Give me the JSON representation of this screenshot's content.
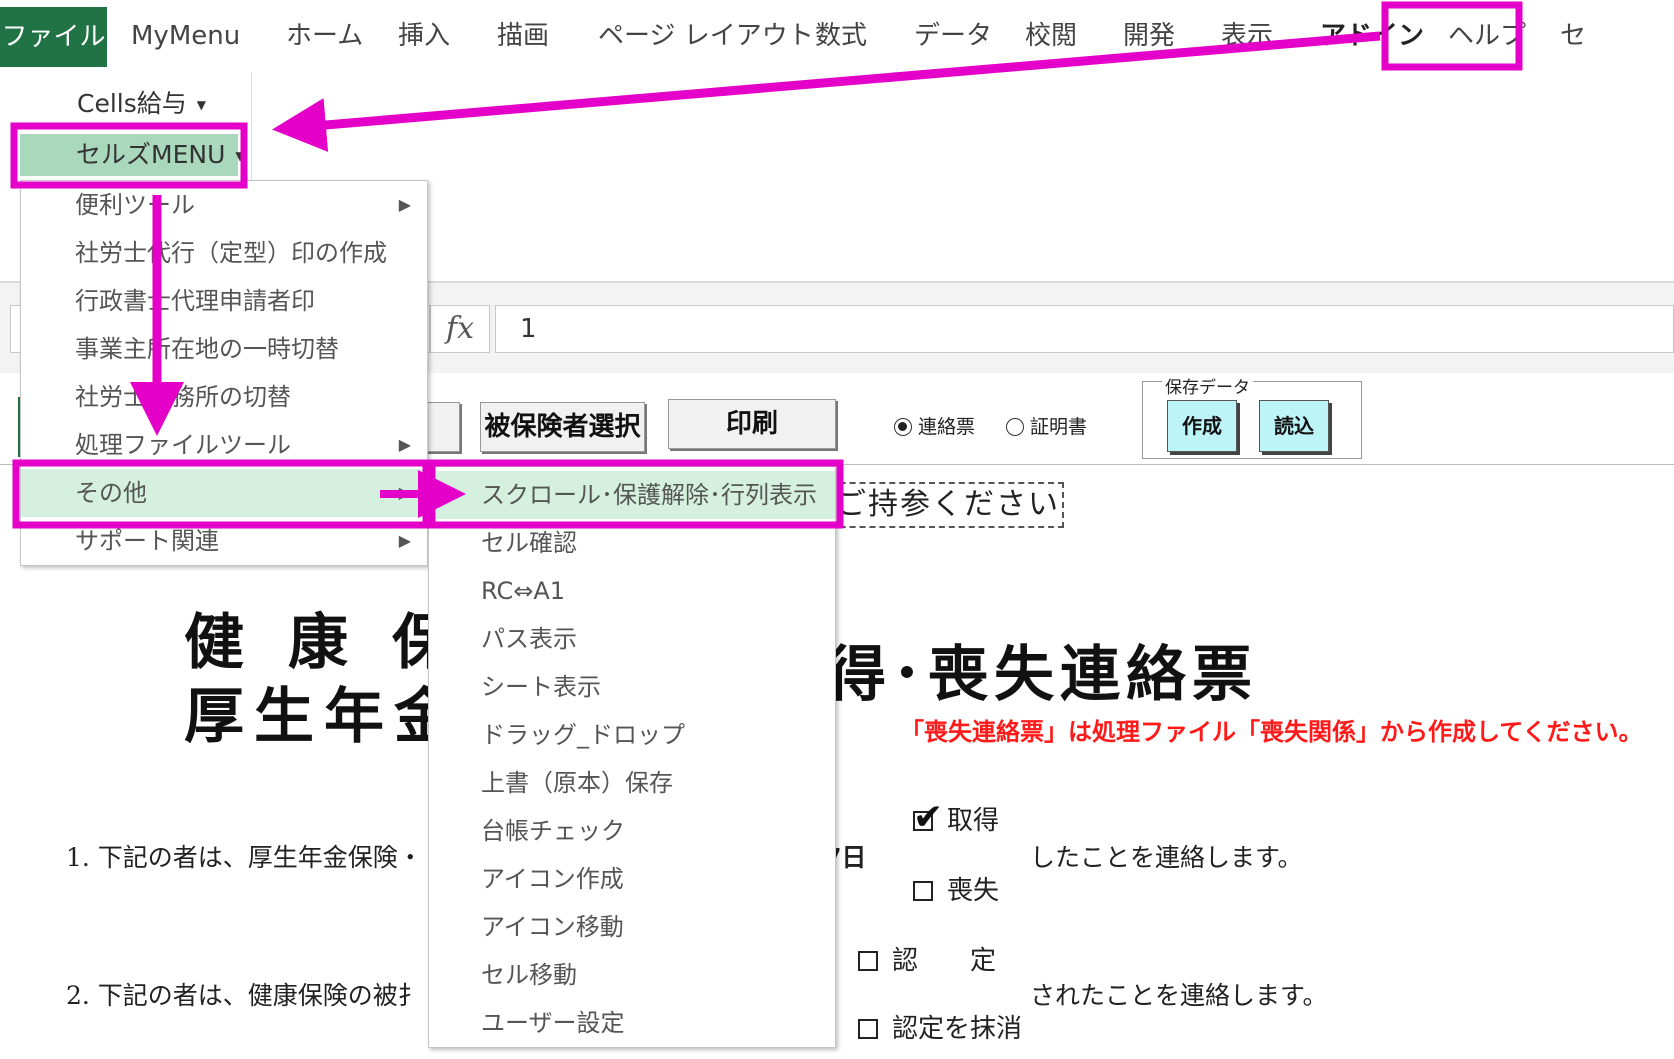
{
  "ribbon": {
    "tabs": [
      "ファイル",
      "MyMenu",
      "ホーム",
      "挿入",
      "描画",
      "ページ レイアウト",
      "数式",
      "データ",
      "校閲",
      "開発",
      "表示",
      "アドイン",
      "ヘルプ",
      "セ"
    ],
    "active_tab": "アドイン",
    "cells_kyuyo": "Cells給与",
    "cells_menu": "セルズMENU"
  },
  "formula_bar": {
    "fx": "fx",
    "value": "1"
  },
  "menu_main": {
    "items": [
      {
        "label": "便利ツール",
        "has_submenu": true
      },
      {
        "label": "社労士代行（定型）印の作成",
        "has_submenu": false
      },
      {
        "label": "行政書士代理申請者印",
        "has_submenu": false
      },
      {
        "label": "事業主所在地の一時切替",
        "has_submenu": false
      },
      {
        "label": "社労士事務所の切替",
        "has_submenu": false
      },
      {
        "label": "処理ファイルツール",
        "has_submenu": true
      },
      {
        "label": "その他",
        "has_submenu": true
      },
      {
        "label": "サポート関連",
        "has_submenu": true
      }
    ],
    "highlighted": "その他"
  },
  "menu_sub": {
    "items": [
      "スクロール･保護解除･行列表示",
      "セル確認",
      "RC⇔A1",
      "パス表示",
      "シート表示",
      "ドラッグ_ドロップ",
      "上書（原本）保存",
      "台帳チェック",
      "アイコン作成",
      "アイコン移動",
      "セル移動",
      "ユーザー設定"
    ],
    "highlighted": "スクロール･保護解除･行列表示"
  },
  "sheet": {
    "btn_hihokensha": "被保険者選択",
    "btn_insatsu": "印刷",
    "radio_renraku": "連絡票",
    "radio_shomei": "証明書",
    "hozon_label": "保存データ",
    "btn_sakusei": "作成",
    "btn_yomikomi": "読込",
    "dashed_note": "ご持参ください",
    "title_line1": "健康保",
    "title_line2": "厚生年金",
    "title_right": "得･喪失連絡票",
    "red_note": "「喪失連絡票」は処理ファイル「喪失関係」から作成してください。",
    "line1": "1. 下記の者は、厚生年金保険・",
    "line1_date": "7日",
    "line1_tail": "したことを連絡します。",
    "chk_shutoku": "取得",
    "chk_soshitsu": "喪失",
    "line2": "2. 下記の者は、健康保険の被扌",
    "chk_nintei": "認　　定",
    "chk_massho": "認定を抹消",
    "line2_tail": "されたことを連絡します。"
  },
  "colors": {
    "excel_green": "#217346",
    "highlight_green": "#a9d8bd",
    "annotation_magenta": "#e400c8",
    "hozon_button": "#bdf4f7",
    "red_note": "#ff1a1a"
  }
}
